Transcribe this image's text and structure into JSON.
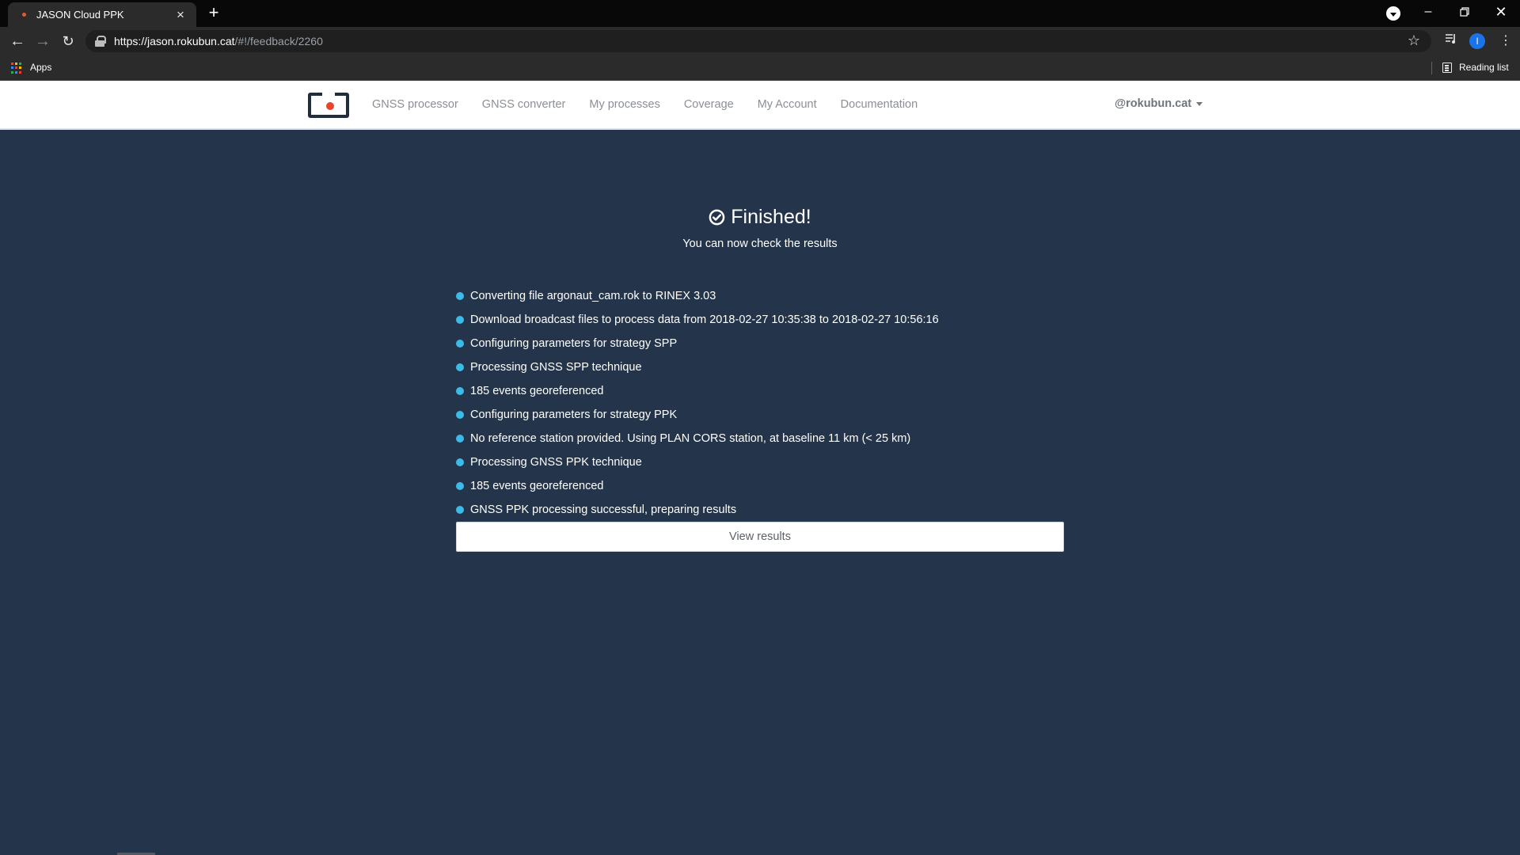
{
  "browser": {
    "tab_title": "JASON Cloud PPK",
    "url_host": "https://jason.rokubun.cat",
    "url_path": "/#!/feedback/2260",
    "bookmark_apps": "Apps",
    "reading_list": "Reading list",
    "profile_initial": "I"
  },
  "navbar": {
    "links": [
      "GNSS processor",
      "GNSS converter",
      "My processes",
      "Coverage",
      "My Account",
      "Documentation"
    ],
    "user": "@rokubun.cat"
  },
  "main": {
    "title": "Finished!",
    "subtitle": "You can now check the results",
    "steps": [
      "Converting file argonaut_cam.rok to RINEX 3.03",
      "Download broadcast files to process data from 2018-02-27 10:35:38 to 2018-02-27 10:56:16",
      "Configuring parameters for strategy SPP",
      "Processing GNSS SPP technique",
      "185 events georeferenced",
      "Configuring parameters for strategy PPK",
      "No reference station provided. Using PLAN CORS station, at baseline 11 km (< 25 km)",
      "Processing GNSS PPK technique",
      "185 events georeferenced",
      "GNSS PPK processing successful, preparing results"
    ],
    "view_results": "View results"
  },
  "colors": {
    "page_bg": "#24344a",
    "bullet": "#3bbce8",
    "logo_dot": "#e5452b"
  }
}
